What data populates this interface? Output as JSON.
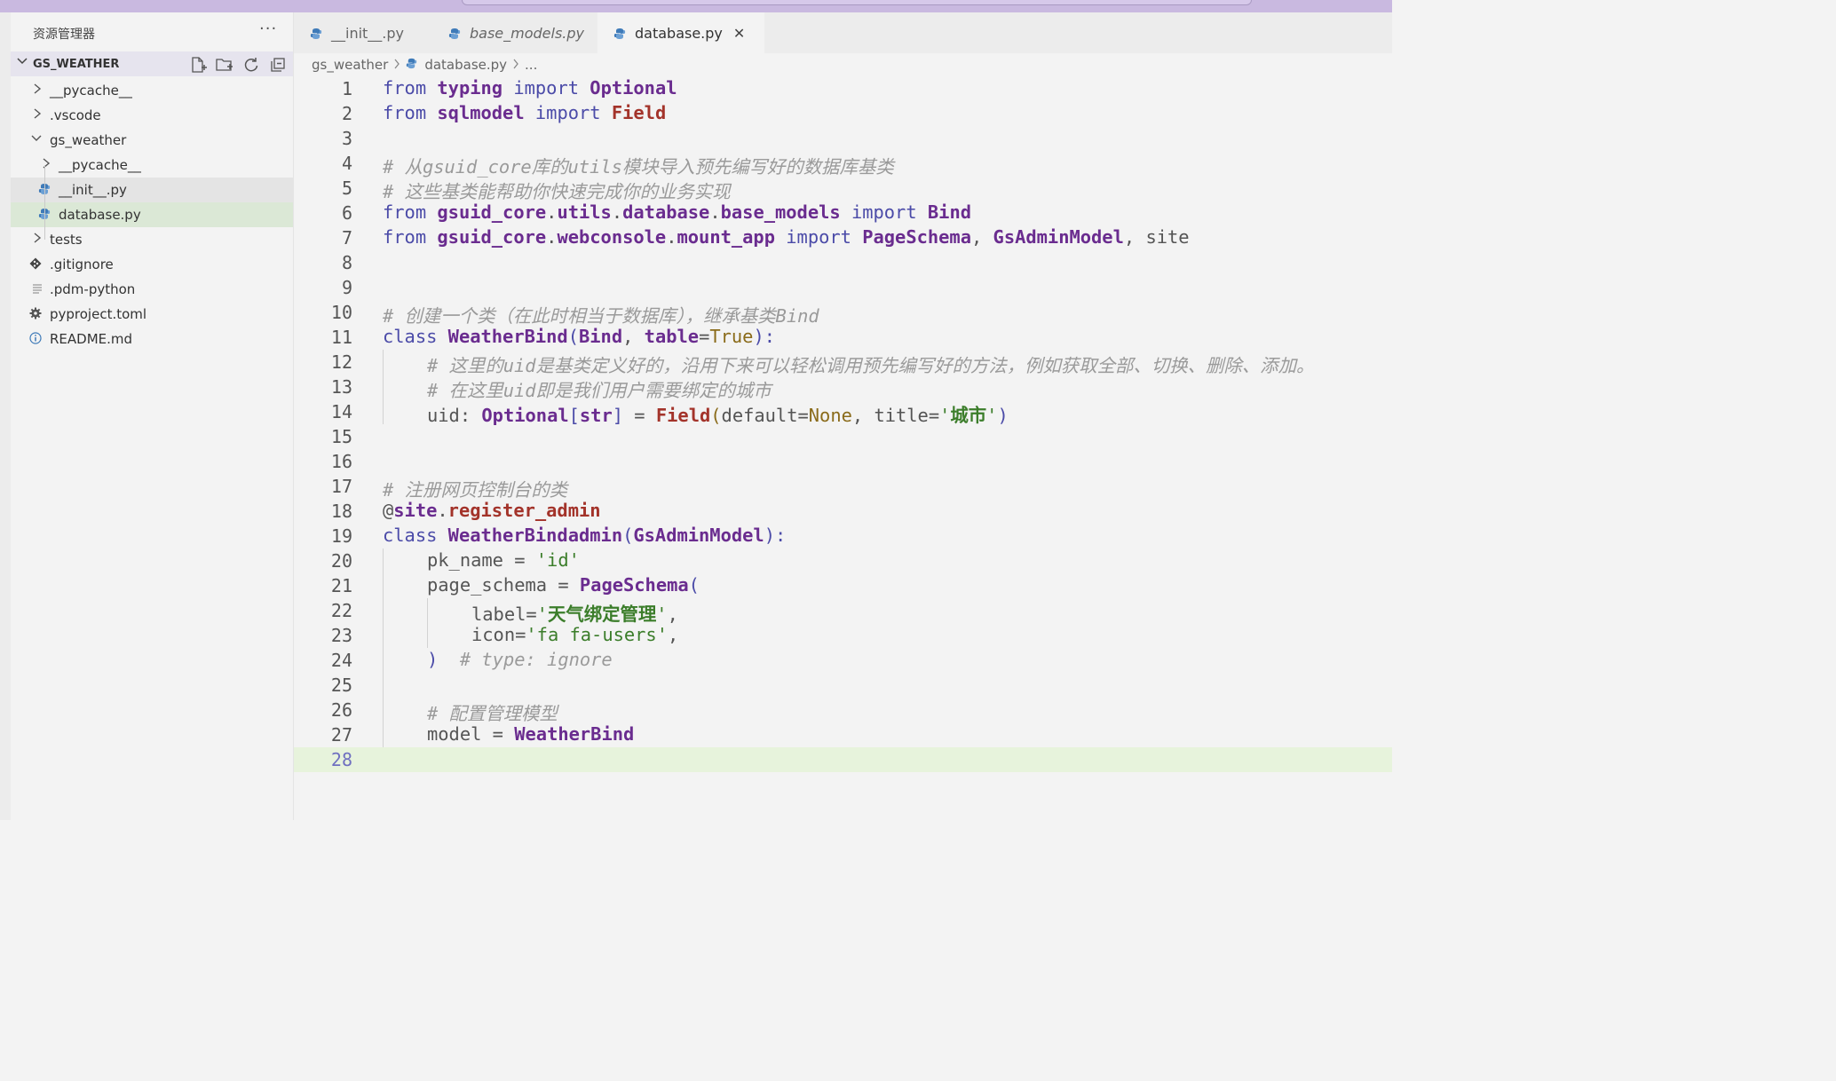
{
  "sidebar": {
    "title": "资源管理器",
    "more": "···",
    "folder": "GS_WEATHER",
    "items": [
      {
        "label": "__pycache__",
        "type": "folder"
      },
      {
        "label": ".vscode",
        "type": "folder"
      },
      {
        "label": "gs_weather",
        "type": "folder-open"
      },
      {
        "label": "__pycache__",
        "type": "folder"
      },
      {
        "label": "__init__.py",
        "type": "python"
      },
      {
        "label": "database.py",
        "type": "python"
      },
      {
        "label": "tests",
        "type": "folder"
      },
      {
        "label": ".gitignore",
        "type": "git"
      },
      {
        "label": ".pdm-python",
        "type": "text"
      },
      {
        "label": "pyproject.toml",
        "type": "settings"
      },
      {
        "label": "README.md",
        "type": "info"
      }
    ]
  },
  "tabs": [
    {
      "label": "__init__.py"
    },
    {
      "label": "base_models.py"
    },
    {
      "label": "database.py",
      "close": "✕"
    }
  ],
  "breadcrumb": {
    "folder": "gs_weather",
    "file": "database.py",
    "more": "..."
  },
  "editor": {
    "line_numbers": [
      "1",
      "2",
      "3",
      "4",
      "5",
      "6",
      "7",
      "8",
      "9",
      "10",
      "11",
      "12",
      "13",
      "14",
      "15",
      "16",
      "17",
      "18",
      "19",
      "20",
      "21",
      "22",
      "23",
      "24",
      "25",
      "26",
      "27",
      "28"
    ],
    "current_line": 28,
    "code": {
      "l1": [
        "from",
        " ",
        "typing",
        " ",
        "import",
        " ",
        "Optional"
      ],
      "l2": [
        "from",
        " ",
        "sqlmodel",
        " ",
        "import",
        " ",
        "Field"
      ],
      "l4": "# 从gsuid_core库的utils模块导入预先编写好的数据库基类",
      "l5": "# 这些基类能帮助你快速完成你的业务实现",
      "l6": [
        "from",
        " ",
        "gsuid_core",
        ".",
        "utils",
        ".",
        "database",
        ".",
        "base_models",
        " ",
        "import",
        " ",
        "Bind"
      ],
      "l7": [
        "from",
        " ",
        "gsuid_core",
        ".",
        "webconsole",
        ".",
        "mount_app",
        " ",
        "import",
        " ",
        "PageSchema",
        ", ",
        "GsAdminModel",
        ", ",
        "site"
      ],
      "l10": "# 创建一个类（在此时相当于数据库），继承基类Bind",
      "l11": [
        "class",
        " ",
        "WeatherBind",
        "(",
        "Bind",
        ", ",
        "table",
        "=",
        "True",
        "):"
      ],
      "l12": "# 这里的uid是基类定义好的，沿用下来可以轻松调用预先编写好的方法，例如获取全部、切换、删除、添加。",
      "l13": "# 在这里uid即是我们用户需要绑定的城市",
      "l14": [
        "uid",
        ": ",
        "Optional",
        "[",
        "str",
        "]",
        " = ",
        "Field",
        "(",
        "default",
        "=",
        "None",
        ", ",
        "title",
        "=",
        "'",
        "城市",
        "'",
        ")"
      ],
      "l17": "# 注册网页控制台的类",
      "l18": [
        "@",
        "site",
        ".",
        "register_admin"
      ],
      "l19": [
        "class",
        " ",
        "WeatherBindadmin",
        "(",
        "GsAdminModel",
        "):"
      ],
      "l20": [
        "pk_name",
        " = ",
        "'id'"
      ],
      "l21": [
        "page_schema",
        " = ",
        "PageSchema",
        "("
      ],
      "l22": [
        "label",
        "=",
        "'",
        "天气绑定管理",
        "'",
        ","
      ],
      "l23": [
        "icon",
        "=",
        "'fa fa-users'",
        ","
      ],
      "l24": [
        ")",
        "  ",
        "# type: ignore"
      ],
      "l26": "# 配置管理模型",
      "l27": [
        "model",
        " = ",
        "WeatherBind"
      ]
    }
  },
  "colors": {
    "keyword": "#4b4ba8",
    "class": "#6a2c8f",
    "function": "#a3332a",
    "string": "#3b7d2a",
    "comment": "#9a9a9a",
    "current_line": "#e7f3dc",
    "active_file_row": "#dbe8d6",
    "python_icon": "#3e7ab8"
  }
}
